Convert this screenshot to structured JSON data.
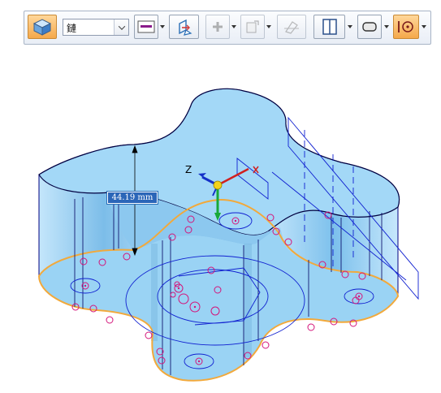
{
  "toolbar": {
    "buttons": [
      {
        "icon": "solid-block-icon",
        "active": true
      },
      {
        "icon": "line-color-icon"
      },
      {
        "icon": "select-edge-icon"
      },
      {
        "icon": "add-point-icon",
        "disabled": true
      },
      {
        "icon": "sketch-plane-icon",
        "disabled": true
      },
      {
        "icon": "disabled-edit-icon",
        "disabled": true
      },
      {
        "icon": "split-view-icon"
      },
      {
        "icon": "rounded-rect-icon"
      },
      {
        "icon": "center-point-icon",
        "active": true
      }
    ],
    "selector": {
      "value": "鏈"
    }
  },
  "viewport": {
    "dimension_label": "44.19 mm",
    "axis_z_label": "Z",
    "part_color": "#9fd5f5",
    "edge_color": "#000080",
    "highlight_color": "#f2a93b",
    "marker_color": "#d4147a"
  }
}
